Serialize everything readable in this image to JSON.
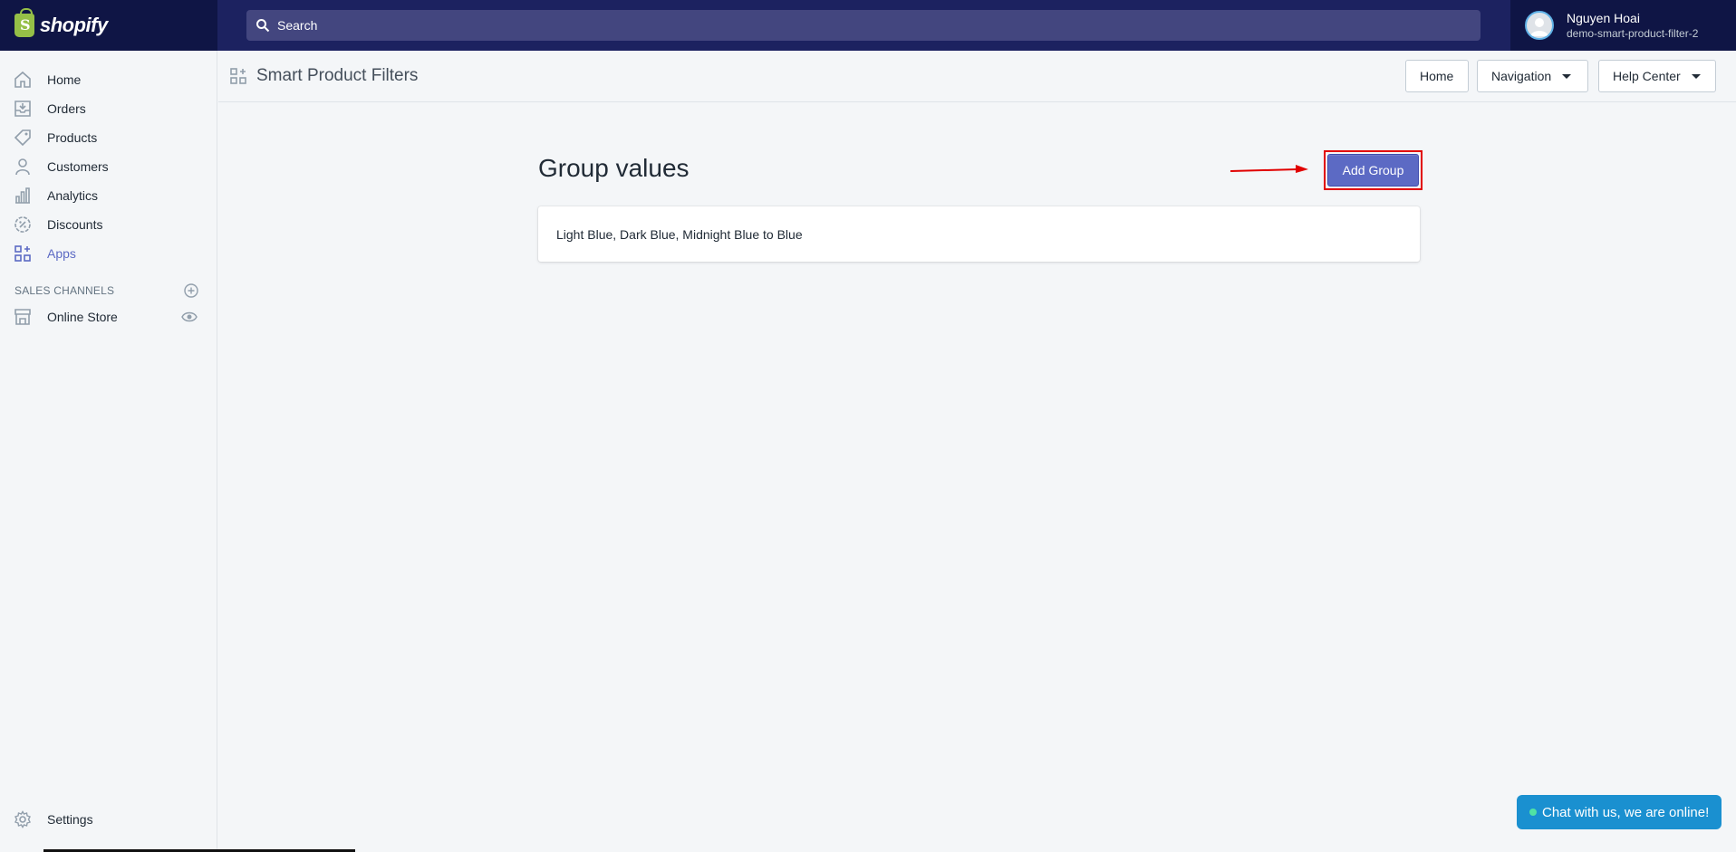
{
  "topbar": {
    "logo_text": "shopify",
    "search_placeholder": "Search",
    "user_name": "Nguyen Hoai",
    "store_name": "demo-smart-product-filter-2"
  },
  "sidebar": {
    "items": [
      {
        "label": "Home",
        "icon": "home-icon"
      },
      {
        "label": "Orders",
        "icon": "orders-icon"
      },
      {
        "label": "Products",
        "icon": "tag-icon"
      },
      {
        "label": "Customers",
        "icon": "person-icon"
      },
      {
        "label": "Analytics",
        "icon": "bar-chart-icon"
      },
      {
        "label": "Discounts",
        "icon": "discount-icon"
      },
      {
        "label": "Apps",
        "icon": "apps-icon"
      }
    ],
    "sales_channels_heading": "SALES CHANNELS",
    "online_store_label": "Online Store",
    "settings_label": "Settings"
  },
  "app_header": {
    "title": "Smart Product Filters",
    "home_btn": "Home",
    "navigation_btn": "Navigation",
    "help_btn": "Help Center"
  },
  "main": {
    "page_title": "Group values",
    "add_group_btn": "Add Group",
    "group_row": "Light Blue, Dark Blue, Midnight Blue to Blue"
  },
  "chat": {
    "label": "Chat with us, we are online!"
  },
  "colors": {
    "topbar": "#1c2260",
    "accent": "#5c6ac4",
    "highlight": "#e10000",
    "chat": "#1a90d0"
  }
}
